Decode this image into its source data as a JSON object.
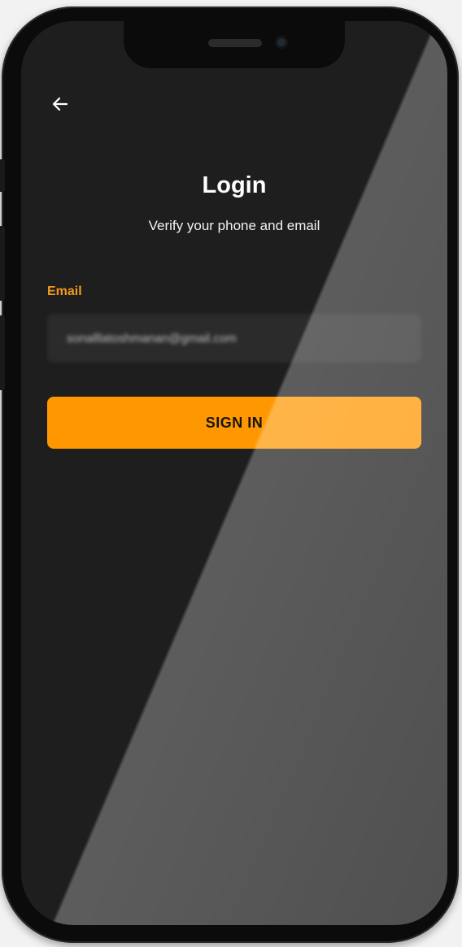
{
  "screen": {
    "title": "Login",
    "subtitle": "Verify your phone and email",
    "email_label": "Email",
    "email_value": "sonalllatoshmanan@gmail.com",
    "sign_in_label": "SIGN IN"
  },
  "icons": {
    "back": "arrow-left-icon"
  },
  "colors": {
    "accent": "#ff9800",
    "label": "#f39a1e",
    "background": "#1e1e1e",
    "input_background": "#2b2b2b"
  }
}
